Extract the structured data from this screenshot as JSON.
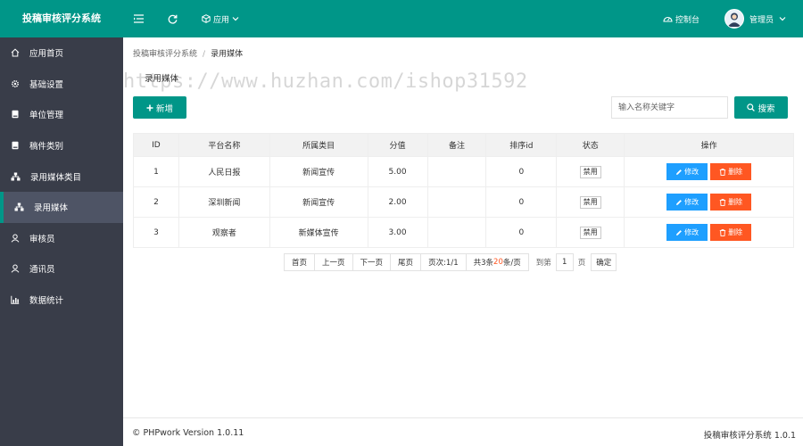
{
  "header": {
    "app_title": "投稿审核评分系统",
    "app_menu_label": "应用",
    "console_label": "控制台",
    "user_label": "管理员"
  },
  "sidebar": {
    "items": [
      {
        "label": "应用首页",
        "icon": "home-icon"
      },
      {
        "label": "基础设置",
        "icon": "gear-icon"
      },
      {
        "label": "单位管理",
        "icon": "book-icon"
      },
      {
        "label": "稿件类别",
        "icon": "book-icon"
      },
      {
        "label": "录用媒体类目",
        "icon": "sitemap-icon"
      },
      {
        "label": "录用媒体",
        "icon": "sitemap-icon",
        "active": true
      },
      {
        "label": "审核员",
        "icon": "user-icon"
      },
      {
        "label": "通讯员",
        "icon": "user-icon"
      },
      {
        "label": "数据统计",
        "icon": "chart-icon"
      }
    ]
  },
  "breadcrumb": {
    "root": "投稿审核评分系统",
    "separator": "/",
    "current": "录用媒体"
  },
  "tab_label": "录用媒体",
  "watermark": "https://www.huzhan.com/ishop31592",
  "toolbar": {
    "add_label": "新增",
    "search_placeholder": "输入名称关键字",
    "search_label": "搜索"
  },
  "table": {
    "headers": [
      "ID",
      "平台名称",
      "所属类目",
      "分值",
      "备注",
      "排序id",
      "状态",
      "操作"
    ],
    "rows": [
      {
        "id": "1",
        "name": "人民日报",
        "category": "新闻宣传",
        "score": "5.00",
        "remark": "",
        "sort": "0",
        "status": "禁用"
      },
      {
        "id": "2",
        "name": "深圳新闻",
        "category": "新闻宣传",
        "score": "2.00",
        "remark": "",
        "sort": "0",
        "status": "禁用"
      },
      {
        "id": "3",
        "name": "观察者",
        "category": "新媒体宣传",
        "score": "3.00",
        "remark": "",
        "sort": "0",
        "status": "禁用"
      }
    ],
    "edit_label": "修改",
    "delete_label": "删除"
  },
  "pagination": {
    "first": "首页",
    "prev": "上一页",
    "next": "下一页",
    "last": "尾页",
    "page_info": "页次:1/1",
    "total_prefix": "共3条 ",
    "per_page": "20",
    "per_page_suffix": "条/页",
    "goto_label": "到第",
    "page_value": "1",
    "page_unit": "页",
    "confirm": "确定"
  },
  "footer": {
    "left": "© PHPwork Version 1.0.11",
    "right": "投稿审核评分系统 1.0.1"
  },
  "colors": {
    "header": "#009688",
    "sidebar": "#393d49",
    "edit": "#1e9fff",
    "delete": "#ff5722"
  }
}
